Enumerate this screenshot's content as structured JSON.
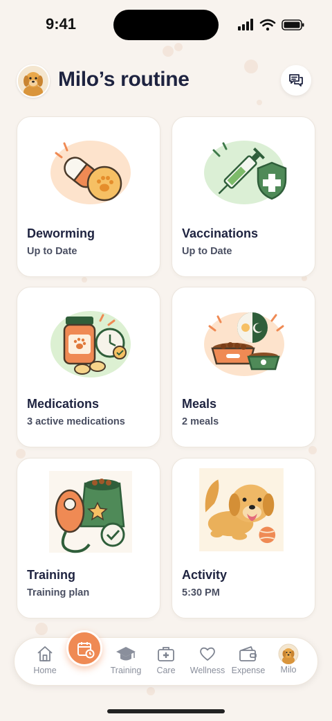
{
  "status_bar": {
    "time": "9:41"
  },
  "header": {
    "title": "Milo’s routine"
  },
  "cards": [
    {
      "title": "Deworming",
      "subtitle": "Up to Date"
    },
    {
      "title": "Vaccinations",
      "subtitle": "Up to Date"
    },
    {
      "title": "Medications",
      "subtitle": "3 active medications"
    },
    {
      "title": "Meals",
      "subtitle": "2 meals"
    },
    {
      "title": "Training",
      "subtitle": "Training plan"
    },
    {
      "title": "Activity",
      "subtitle": "5:30 PM"
    }
  ],
  "tabbar": {
    "items": [
      {
        "label": "Home",
        "icon": "home-icon"
      },
      {
        "label": "Training",
        "icon": "graduation-cap-icon"
      },
      {
        "label": "Care",
        "icon": "medical-kit-icon"
      },
      {
        "label": "Wellness",
        "icon": "heart-icon"
      },
      {
        "label": "Expense",
        "icon": "wallet-icon"
      },
      {
        "label": "Milo",
        "icon": "pet-avatar"
      }
    ],
    "fab_icon": "calendar-clock-icon"
  },
  "colors": {
    "accent": "#ef8a54",
    "title": "#1e2340",
    "background": "#f8f3ee"
  }
}
